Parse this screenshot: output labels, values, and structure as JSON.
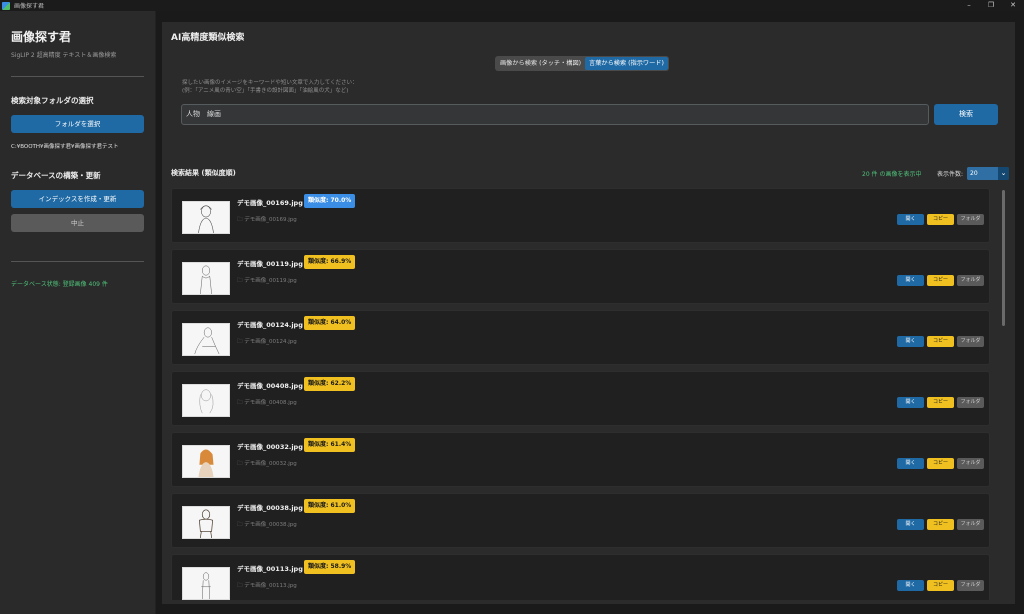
{
  "window": {
    "title": "画像探す君",
    "controls": [
      "–",
      "❐",
      "✕"
    ]
  },
  "sidebar": {
    "app_title": "画像探す君",
    "app_subtitle": "SigLIP 2 超高精度 テキスト＆画像検索",
    "folder_section": "検索対象フォルダの選択",
    "select_folder_label": "フォルダを選択",
    "folder_path": "C:¥BOOTH¥画像探す君¥画像探す君テスト",
    "db_section": "データベースの構築・更新",
    "build_index_label": "インデックスを作成・更新",
    "stop_label": "中止",
    "db_status": "データベース状態: 登録画像 409 件"
  },
  "main": {
    "title": "AI高精度類似検索",
    "mode_tabs": [
      {
        "label": "画像から検索 (タッチ・構図)",
        "active": false
      },
      {
        "label": "言葉から検索 (指示ワード)",
        "active": true
      }
    ],
    "hint_line1": "探したい画像のイメージをキーワードや短い文章で入力してください：",
    "hint_line2": "(例：「アニメ風の青い空」「手書きの設計図面」「油絵風の犬」など)",
    "search_value": "人物　線画",
    "search_button": "検索",
    "results_header": "検索結果 (類似度順)",
    "results_count": "20 件 の画像を表示中",
    "per_page_label": "表示件数:",
    "per_page_value": "20",
    "results": [
      {
        "name": "デモ画像_00169.jpg",
        "similarity": "類似度: 70.0%",
        "file": "デモ画像_00169.jpg",
        "top": true
      },
      {
        "name": "デモ画像_00119.jpg",
        "similarity": "類似度: 66.9%",
        "file": "デモ画像_00119.jpg",
        "top": false
      },
      {
        "name": "デモ画像_00124.jpg",
        "similarity": "類似度: 64.0%",
        "file": "デモ画像_00124.jpg",
        "top": false
      },
      {
        "name": "デモ画像_00408.jpg",
        "similarity": "類似度: 62.2%",
        "file": "デモ画像_00408.jpg",
        "top": false
      },
      {
        "name": "デモ画像_00032.jpg",
        "similarity": "類似度: 61.4%",
        "file": "デモ画像_00032.jpg",
        "top": false
      },
      {
        "name": "デモ画像_00038.jpg",
        "similarity": "類似度: 61.0%",
        "file": "デモ画像_00038.jpg",
        "top": false
      },
      {
        "name": "デモ画像_00113.jpg",
        "similarity": "類似度: 58.9%",
        "file": "デモ画像_00113.jpg",
        "top": false
      }
    ],
    "result_buttons": {
      "open": "開く",
      "copy": "コピー",
      "folder": "フォルダ"
    },
    "file_icon": "folder-icon"
  },
  "colors": {
    "accent": "#1f6aa5",
    "badge_top": "#3a8ee6",
    "badge": "#f0c020",
    "status_green": "#4fc17a"
  }
}
